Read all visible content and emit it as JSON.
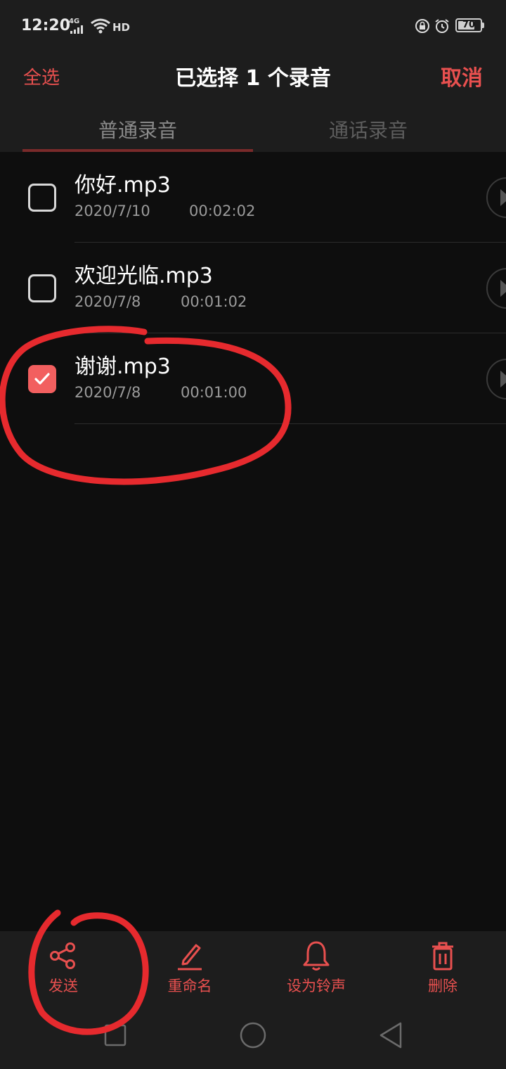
{
  "status_bar": {
    "time": "12:20",
    "network": "4G",
    "hd": "HD",
    "battery": "70"
  },
  "header": {
    "select_all": "全选",
    "title": "已选择 1 个录音",
    "cancel": "取消"
  },
  "tabs": [
    {
      "label": "普通录音",
      "active": true
    },
    {
      "label": "通话录音",
      "active": false
    }
  ],
  "recordings": [
    {
      "name": "你好.mp3",
      "date": "2020/7/10",
      "duration": "00:02:02",
      "checked": false
    },
    {
      "name": "欢迎光临.mp3",
      "date": "2020/7/8",
      "duration": "00:01:02",
      "checked": false
    },
    {
      "name": "谢谢.mp3",
      "date": "2020/7/8",
      "duration": "00:01:00",
      "checked": true
    }
  ],
  "actions": [
    {
      "label": "发送",
      "icon": "share-icon"
    },
    {
      "label": "重命名",
      "icon": "pencil-icon"
    },
    {
      "label": "设为铃声",
      "icon": "bell-icon"
    },
    {
      "label": "删除",
      "icon": "trash-icon"
    }
  ],
  "colors": {
    "accent": "#e8504f",
    "checkbox_checked": "#f25f5f",
    "background": "#0e0e0e",
    "bar": "#1d1d1d"
  }
}
